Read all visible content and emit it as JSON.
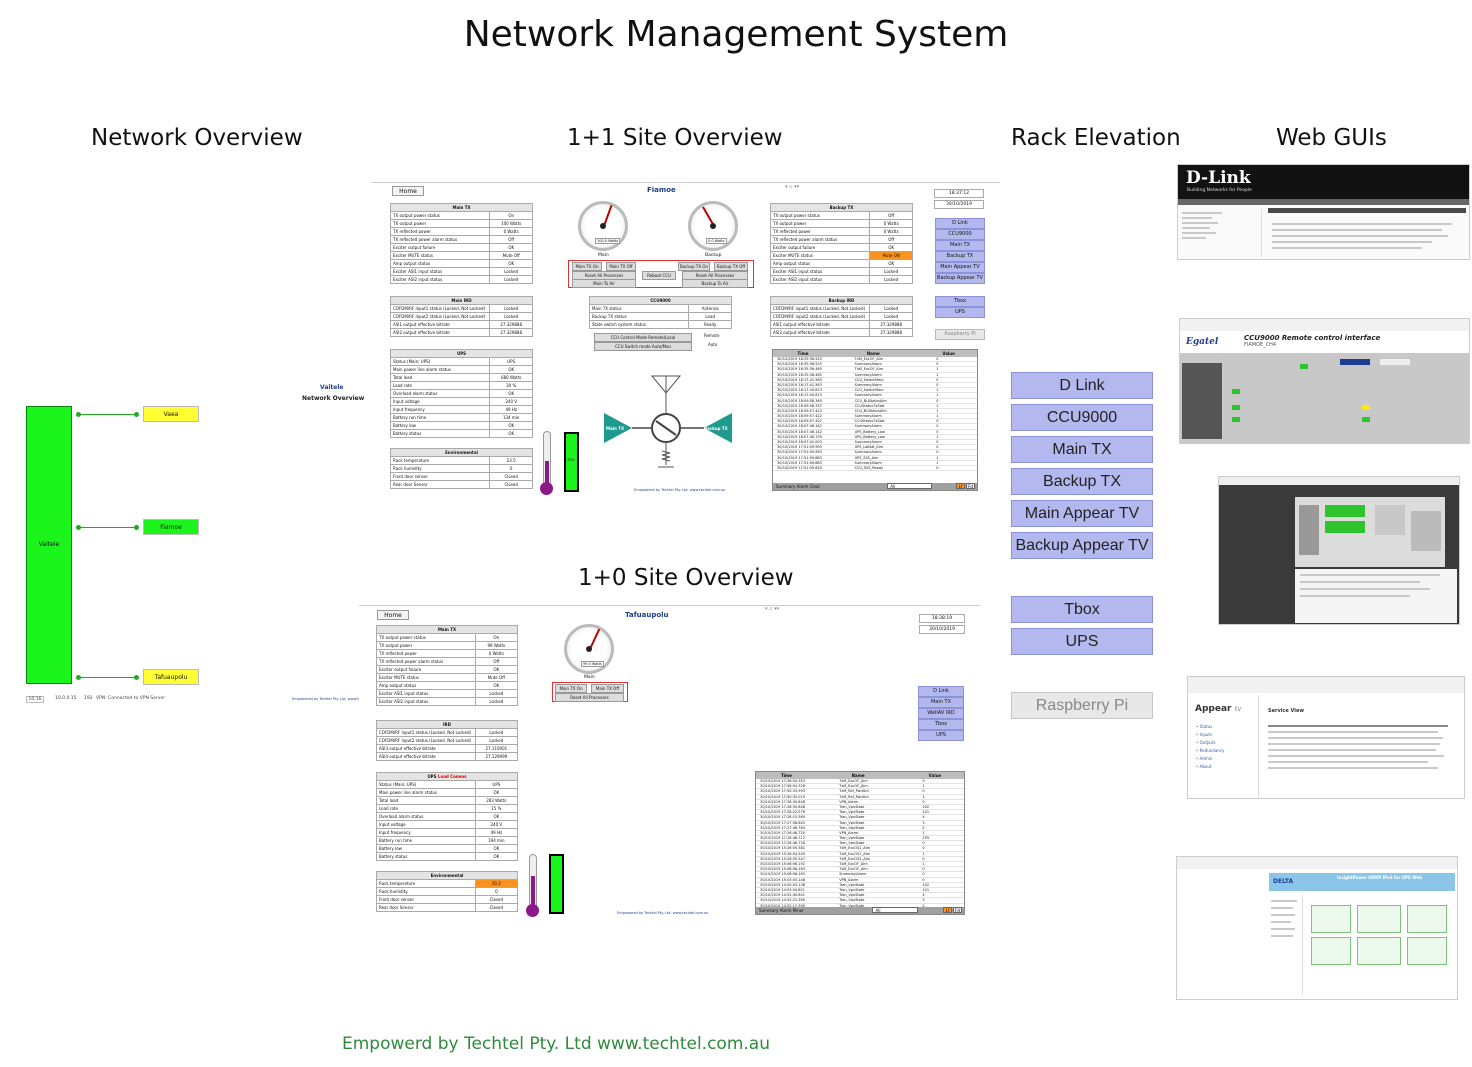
{
  "page": {
    "title": "Network Management System",
    "footer": "Empowerd by Techtel Pty. Ltd www.techtel.com.au"
  },
  "sections": {
    "network_overview": "Network Overview",
    "site_1plus1": "1+1 Site Overview",
    "site_1plus0": "1+0 Site Overview",
    "rack_elevation": "Rack Elevation",
    "web_guis": "Web GUIs"
  },
  "network": {
    "header_title": "Vaitele",
    "header_sub": "Network Overview",
    "hub": "Vaitele",
    "nodes": [
      "Vaea",
      "Fiamoe",
      "Tafuaupolu"
    ],
    "status": [
      "10:16",
      "10.0.0.15",
      "192",
      "VPN: Connected to VPN Server"
    ],
    "credit": "Empowered by Techtel Pty. Ltd. www.techtel.com.au",
    "colors": {
      "hub": "#1cf51c",
      "node_ok": "#1cf51c",
      "node_warn": "#ffff33"
    }
  },
  "site_a": {
    "home": "Home",
    "name": "Fiamoe",
    "clock": [
      "18:37:12",
      "30/10/2019"
    ],
    "main_tx_title": "Main TX",
    "main_tx": [
      [
        "TX output power status",
        "On"
      ],
      [
        "TX output power",
        "100 Watts"
      ],
      [
        "TX reflected power",
        "0 Watts"
      ],
      [
        "TX reflected power alarm status",
        "Off"
      ],
      [
        "Exciter output failure",
        "OK"
      ],
      [
        "Exciter MUTE status",
        "Mute Off"
      ],
      [
        "Amp output status",
        "OK"
      ],
      [
        "Exciter ASI1 input status",
        "Locked"
      ],
      [
        "Exciter ASI2 input status",
        "Locked"
      ]
    ],
    "main_ird_title": "Main IRD",
    "main_ird": [
      [
        "COFDM/RF input1 status (Locked, Not Locked)",
        "Locked"
      ],
      [
        "COFDM/RF input2 status (Locked, Not Locked)",
        "Locked"
      ],
      [
        "ASI1 output effective bitrate",
        "27.329888"
      ],
      [
        "ASI2 output effective bitrate",
        "27.329888"
      ]
    ],
    "ups_title": "UPS",
    "ups": [
      [
        "Status (Main: UPS)",
        "UPS"
      ],
      [
        "Main power line alarm status",
        "OK"
      ],
      [
        "Total load",
        "680 Watts"
      ],
      [
        "Load rate",
        "30 %"
      ],
      [
        "Overload alarm status",
        "OK"
      ],
      [
        "Input voltage",
        "240 V"
      ],
      [
        "Input frequency",
        "49 Hz"
      ],
      [
        "Battery run time",
        "134 min"
      ],
      [
        "Battery low",
        "OK"
      ],
      [
        "Battery status",
        "OK"
      ]
    ],
    "env_title": "Environmental",
    "env": [
      [
        "Rack temperature",
        "23.5"
      ],
      [
        "Rack humidity",
        "0"
      ],
      [
        "Front door sensor",
        "Closed"
      ],
      [
        "Rear door Sensor",
        "Closed"
      ]
    ],
    "backup_tx_title": "Backup TX",
    "backup_tx": [
      [
        "TX output power status",
        "Off"
      ],
      [
        "TX output power",
        "0 Watts"
      ],
      [
        "TX reflected power",
        "0 Watts"
      ],
      [
        "TX reflected power alarm status",
        "Off"
      ],
      [
        "Exciter output failure",
        "OK"
      ],
      [
        "Exciter MUTE status",
        "Mute ON"
      ],
      [
        "Amp output status",
        "OK"
      ],
      [
        "Exciter ASI1 input status",
        "Locked"
      ],
      [
        "Exciter ASI2 input status",
        "Locked"
      ]
    ],
    "backup_ird_title": "Backup IRD",
    "backup_ird": [
      [
        "COFDM/RF input1 status (Locked, Not Locked)",
        "Locked"
      ],
      [
        "COFDM/RF input2 status (Locked, Not Locked)",
        "Locked"
      ],
      [
        "ASI1 output effective bitrate",
        "27.329888"
      ],
      [
        "ASI2 output effective bitrate",
        "27.329888"
      ]
    ],
    "ccu_title": "CCU9000",
    "ccu": [
      [
        "Main TX status",
        "Antenna"
      ],
      [
        "Backup TX status",
        "Load"
      ],
      [
        "State switch system status",
        "Ready"
      ]
    ],
    "ccu_controls": [
      "CCU Control Mode Remote/Local",
      "CCU Switch mode Auto/Man"
    ],
    "ccu_values": [
      "Remote",
      "Auto"
    ],
    "gauge_main": "Main",
    "gauge_backup": "Backup",
    "gauge_main_value": "100.0 Watts",
    "gauge_backup_value": "0.0 Watts",
    "controls_main": [
      "Main TX On",
      "Main TX Off",
      "Reset All Processes",
      "Main To Air"
    ],
    "controls_backup": [
      "Backup TX On",
      "Backup TX Off",
      "Reset All Processes",
      "Backup To Air"
    ],
    "reboot": "Reboot CCU",
    "tx_labels": [
      "Main TX",
      "Backup TX"
    ],
    "rack": [
      "D Link",
      "CCU9000",
      "Main TX",
      "Backup TX",
      "Main Appear TV",
      "Backup Appear TV",
      "Tbox",
      "UPS",
      "Raspberry Pi"
    ],
    "battery_label": "75%",
    "credit": "Empowered by Techtel Pty. Ltd. www.techtel.com.au",
    "alarm_headers": [
      "Time",
      "Name",
      "Value"
    ],
    "alarms": [
      [
        "30/10/2019 18:35:36.525",
        "TxM_ExcOF_Alm",
        "0"
      ],
      [
        "30/10/2019 18:35:36.525",
        "SummaryAlarm",
        "0"
      ],
      [
        "30/10/2019 18:35:36.465",
        "TxM_ExcOF_Alm",
        "1"
      ],
      [
        "30/10/2019 18:35:36.465",
        "SummaryAlarm",
        "1"
      ],
      [
        "30/10/2019 18:17:41.563",
        "CCU_SwitchMain",
        "0"
      ],
      [
        "30/10/2019 18:17:41.563",
        "SummaryAlarm",
        "0"
      ],
      [
        "30/10/2019 18:17:40.813",
        "CCU_SwitchMain",
        "1"
      ],
      [
        "30/10/2019 18:17:40.813",
        "SummaryAlarm",
        "1"
      ],
      [
        "30/10/2019 18:09:58.365",
        "CCU_BUStatusAlm",
        "0"
      ],
      [
        "30/10/2019 18:09:58.337",
        "CCUStatusTxStat",
        "1"
      ],
      [
        "30/10/2019 18:09:57.422",
        "CCU_BUStatusAlm",
        "1"
      ],
      [
        "30/10/2019 18:09:57.422",
        "SummaryAlarm",
        "1"
      ],
      [
        "30/10/2019 18:09:57.422",
        "CCUStatusTxStat",
        "0"
      ],
      [
        "30/10/2019 18:07:46.142",
        "SummaryAlarm",
        "0"
      ],
      [
        "30/10/2019 18:07:46.142",
        "UPS_Battery_Low",
        "0"
      ],
      [
        "30/10/2019 18:07:46.139",
        "UPS_Battery_Low",
        "1"
      ],
      [
        "30/10/2019 18:07:41.003",
        "SummaryAlarm",
        "0"
      ],
      [
        "30/10/2019 17:51:09.993",
        "UPS_LoBatt_Alm",
        "0"
      ],
      [
        "30/10/2019 17:51:09.993",
        "SummaryAlarm",
        "0"
      ],
      [
        "30/10/2019 17:51:09.883",
        "UPS_SSS_Alm",
        "1"
      ],
      [
        "30/10/2019 17:51:09.883",
        "SummaryAlarm",
        "1"
      ],
      [
        "30/10/2019 17:51:09.830",
        "CCU_SSS_Ready",
        "0"
      ]
    ],
    "alarm_footer": "Summary Alarm Clear",
    "alarm_filter": "All",
    "alarm_buttons": [
      "Lf",
      "Fd"
    ],
    "colors": {
      "accent": "#1e9a8e",
      "warn": "#f7931e",
      "ok": "#1cf51c",
      "rack": "#b3b9ee"
    }
  },
  "site_b": {
    "home": "Home",
    "name": "Tafuaupolu",
    "clock": [
      "18:38:19",
      "30/10/2019"
    ],
    "main_tx_title": "Main TX",
    "main_tx": [
      [
        "TX output power status",
        "On"
      ],
      [
        "TX output power",
        "99 Watts"
      ],
      [
        "TX reflected power",
        "0 Watts"
      ],
      [
        "TX reflected power alarm status",
        "Off"
      ],
      [
        "Exciter output failure",
        "OK"
      ],
      [
        "Exciter MUTE status",
        "Mute Off"
      ],
      [
        "Amp output status",
        "OK"
      ],
      [
        "Exciter ASI1 input status",
        "Locked"
      ],
      [
        "Exciter ASI2 input status",
        "Locked"
      ]
    ],
    "ird_title": "IRD",
    "ird": [
      [
        "COFDM/RF input1 status (Locked, Not Locked)",
        "Locked"
      ],
      [
        "COFDM/RF input2 status (Locked, Not Locked)",
        "Locked"
      ],
      [
        "ASI3 output effective bitrate",
        "27.110001"
      ],
      [
        "ASI4 output effective bitrate",
        "27.129999"
      ]
    ],
    "ups_title": "UPS",
    "ups_note": "Load Comms",
    "ups": [
      [
        "Status (Main: UPS)",
        "UPS"
      ],
      [
        "Main power line alarm status",
        "OK"
      ],
      [
        "Total load",
        "283 Watts"
      ],
      [
        "Load rate",
        "15 %"
      ],
      [
        "Overload alarm status",
        "OK"
      ],
      [
        "Input voltage",
        "240 V"
      ],
      [
        "Input frequency",
        "49 Hz"
      ],
      [
        "Battery run time",
        "194 min"
      ],
      [
        "Battery low",
        "OK"
      ],
      [
        "Battery status",
        "OK"
      ]
    ],
    "env_title": "Environmental",
    "env": [
      [
        "Rack temperature",
        "30.2"
      ],
      [
        "Rack humidity",
        "0"
      ],
      [
        "Front door sensor",
        "Closed"
      ],
      [
        "Rear door Sensor",
        "Closed"
      ]
    ],
    "gauge_main": "Main",
    "gauge_main_value": "99.0 Watts",
    "controls": [
      "Main TX On",
      "Main TX Off",
      "Reset All Processes"
    ],
    "rack": [
      "D Link",
      "Main TX",
      "WellAV IRD",
      "Tbox",
      "UPS"
    ],
    "credit": "Empowered by Techtel Pty. Ltd. www.techtel.com.au",
    "alarm_headers": [
      "Time",
      "Name",
      "Value"
    ],
    "alarms": [
      [
        "30/10/2019 17:56:54.353",
        "TxM_ExcOF_Alm",
        "0"
      ],
      [
        "30/10/2019 17:56:54.326",
        "TxM_ExcOF_Alm",
        "1"
      ],
      [
        "30/10/2019 17:50:33.993",
        "TxM_Ref_PwrAlm",
        "0"
      ],
      [
        "30/10/2019 17:50:33.015",
        "TxM_Ref_PwrAlm",
        "1"
      ],
      [
        "30/10/2019 17:28:30.848",
        "VPN_Alarm",
        "0"
      ],
      [
        "30/10/2019 17:28:30.848",
        "Tran_VpnState",
        "102"
      ],
      [
        "30/10/2019 17:28:22.578",
        "Tran_VpnState",
        "101"
      ],
      [
        "30/10/2019 17:28:15.560",
        "Tran_VpnState",
        "4"
      ],
      [
        "30/10/2019 17:27:58.843",
        "Tran_VpnState",
        "3"
      ],
      [
        "30/10/2019 17:27:46.764",
        "Tran_VpnState",
        "2"
      ],
      [
        "30/10/2019 17:26:46.720",
        "VPN_Alarm",
        "1"
      ],
      [
        "30/10/2019 17:26:46.712",
        "Tran_VpnState",
        "255"
      ],
      [
        "30/10/2019 17:26:46.728",
        "Tran_VpnState",
        "0"
      ],
      [
        "30/10/2019 15:26:55.581",
        "TxM_ExcOS1_Alm",
        "0"
      ],
      [
        "30/10/2019 15:26:54.549",
        "TxM_ExcOS1_Alm",
        "1"
      ],
      [
        "30/10/2019 15:26:55.547",
        "TxM_ExcOS1_Alm",
        "0"
      ],
      [
        "30/10/2019 15:06:56.192",
        "TxM_ExcOF_Alm",
        "1"
      ],
      [
        "30/10/2019 15:06:56.163",
        "TxM_ExcOF_Alm",
        "0"
      ],
      [
        "30/10/2019 15:06:56.163",
        "SummaryAlarm",
        "0"
      ],
      [
        "30/10/2019 15:03:03.148",
        "VPN_Alarm",
        "0"
      ],
      [
        "30/10/2019 14:55:03.138",
        "Tran_VpnState",
        "102"
      ],
      [
        "30/10/2019 14:53:54.821",
        "Tran_VpnState",
        "101"
      ],
      [
        "30/10/2019 14:52:40.641",
        "Tran_VpnState",
        "4"
      ],
      [
        "30/10/2019 14:52:21.390",
        "Tran_VpnState",
        "3"
      ],
      [
        "30/10/2019 14:52:17.390",
        "Tran_VpnState",
        "2"
      ]
    ],
    "alarm_footer": "Summary Alarm Minor",
    "alarm_filter": "All",
    "alarm_buttons": [
      "Lf",
      "Fd"
    ]
  },
  "rack_elevation": {
    "buttons": [
      "D Link",
      "CCU9000",
      "Main TX",
      "Backup TX",
      "Main Appear TV",
      "Backup Appear TV",
      "Tbox",
      "UPS",
      "Raspberry Pi"
    ],
    "colors": {
      "button": "#b3b9ee",
      "disabled": "#e8e8e8"
    }
  },
  "web_guis": {
    "dlink_logo": "D-Link",
    "dlink_tag": "Building Networks for People",
    "egatel_logo": "Egatel",
    "egatel_title": "CCU9000 Remote control interface",
    "egatel_sub": "FIAMOE_CH4",
    "appear_logo": "Appear",
    "appear_logo_suffix": "tv",
    "appear_title": "Service View",
    "appear_menu": [
      "Status",
      "Inputs",
      "Outputs",
      "Redundancy",
      "Admin",
      "About"
    ],
    "delta_logo": "DELTA",
    "delta_title": "InsightPower SNMP IPv6 for UPS Web"
  }
}
